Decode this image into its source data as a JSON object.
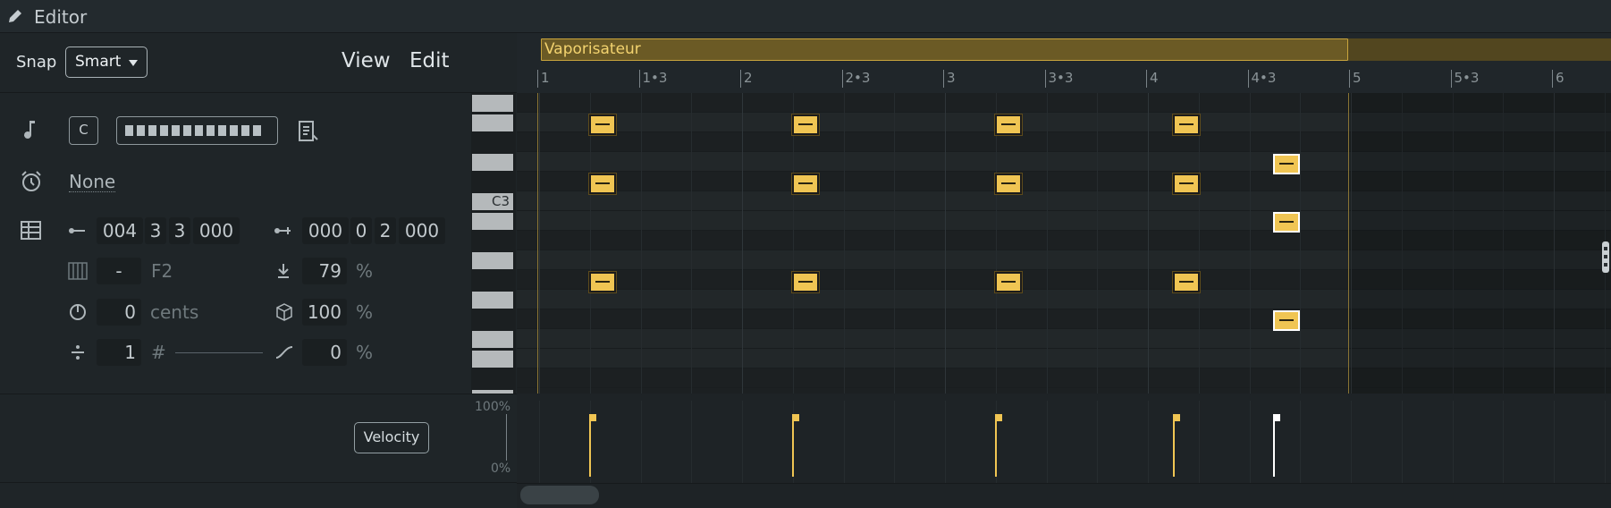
{
  "header": {
    "title": "Editor",
    "icon": "pencil-icon"
  },
  "toolbar": {
    "snap_label": "Snap",
    "snap_value": "Smart",
    "view_label": "View",
    "edit_label": "Edit"
  },
  "inspector": {
    "key_value": "C",
    "scale_icon": "scale-icon",
    "groove_value": "None",
    "position": [
      "004",
      "3",
      "3",
      "000"
    ],
    "length": [
      "000",
      "0",
      "2",
      "000"
    ],
    "pitch_dash": "-",
    "pitch_note": "F2",
    "velocity": "79",
    "velocity_unit": "%",
    "fine": "0",
    "fine_unit": "cents",
    "chance": "100",
    "chance_unit": "%",
    "repeat": "1",
    "repeat_unit": "#",
    "curve": "0",
    "curve_unit": "%"
  },
  "keyboard": {
    "c3_label": "C3"
  },
  "clip": {
    "name": "Vaporisateur"
  },
  "timeline": {
    "ticks": [
      "1",
      "1.3",
      "2",
      "2.3",
      "3",
      "3.3",
      "4",
      "4.3",
      "5",
      "5.3",
      "6"
    ]
  },
  "velocity_lane": {
    "button": "Velocity",
    "max_label": "100%",
    "min_label": "0%"
  },
  "colors": {
    "accent": "#f0c553",
    "clip_border": "#c9a43c",
    "background": "#1e2326"
  }
}
